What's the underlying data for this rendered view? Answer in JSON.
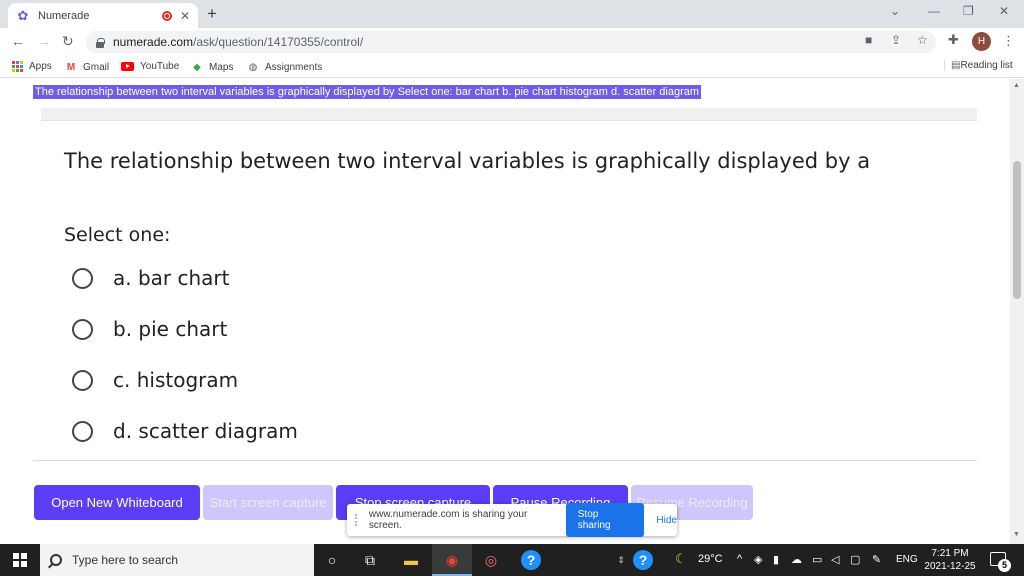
{
  "browser": {
    "tab_title": "Numerade",
    "url_host": "numerade.com",
    "url_path": "/ask/question/14170355/control/",
    "profile_initial": "H",
    "bookmarks": [
      "Apps",
      "Gmail",
      "YouTube",
      "Maps",
      "Assignments"
    ],
    "reading_list": "Reading list"
  },
  "page": {
    "highlighted_text": "The relationship between two interval variables is graphically displayed by Select one: bar chart b. pie chart histogram d. scatter diagram",
    "question": "The relationship between two interval variables is graphically displayed by a",
    "select_label": "Select one:",
    "options": [
      "a. bar chart",
      "b. pie chart",
      "c. histogram",
      "d. scatter diagram"
    ],
    "buttons": {
      "open_whiteboard": "Open New Whiteboard",
      "start_capture": "Start screen capture",
      "stop_capture": "Stop screen capture",
      "pause_recording": "Pause Recording",
      "resume_recording": "Resume Recording"
    },
    "share_banner": {
      "message": "www.numerade.com is sharing your screen.",
      "stop_label": "Stop sharing",
      "hide_label": "Hide"
    }
  },
  "taskbar": {
    "search_placeholder": "Type here to search",
    "temperature": "29°C",
    "language": "ENG",
    "time": "7:21 PM",
    "date": "2021-12-25",
    "notification_count": "5"
  },
  "colors": {
    "accent": "#5b3df5",
    "highlight": "#6f5de6",
    "disabled_button": "#cfc6fb",
    "share_blue": "#1a73e8"
  }
}
